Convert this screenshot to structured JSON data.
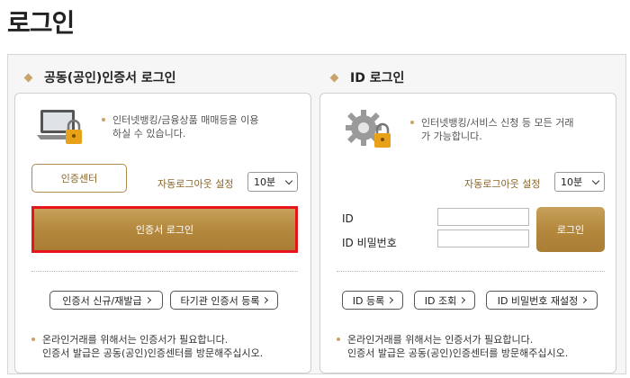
{
  "page": {
    "title": "로그인"
  },
  "cert": {
    "heading": "공동(공인)인증서 로그인",
    "description": [
      "인터넷뱅킹/금융상품 매매등을 이용",
      "하실 수 있습니다."
    ],
    "center_button": "인증센터",
    "auto_logout_label": "자동로그아웃 설정",
    "auto_logout_value": "10분",
    "login_button": "인증서 로그인",
    "links": [
      "인증서 신규/재발급",
      "타기관 인증서 등록"
    ],
    "footer": [
      "온라인거래를 위해서는 인증서가 필요합니다.",
      "인증서 발급은 공동(공인)인증센터를 방문해주십시오."
    ]
  },
  "id": {
    "heading": "ID 로그인",
    "description": [
      "인터넷뱅킹/서비스 신청 등 모든 거래",
      "가 가능합니다."
    ],
    "auto_logout_label": "자동로그아웃 설정",
    "auto_logout_value": "10분",
    "id_label": "ID",
    "password_label": "ID 비밀번호",
    "login_button": "로그인",
    "links": [
      "ID 등록",
      "ID 조회",
      "ID 비밀번호 재설정"
    ],
    "footer": [
      "온라인거래를 위해서는 인증서가 필요합니다.",
      "인증서 발급은 공동(공인)인증센터를 방문해주십시오."
    ]
  },
  "colors": {
    "accent": "#c9a46a",
    "gold_button": "#b4893e",
    "highlight": "#e8141b"
  }
}
